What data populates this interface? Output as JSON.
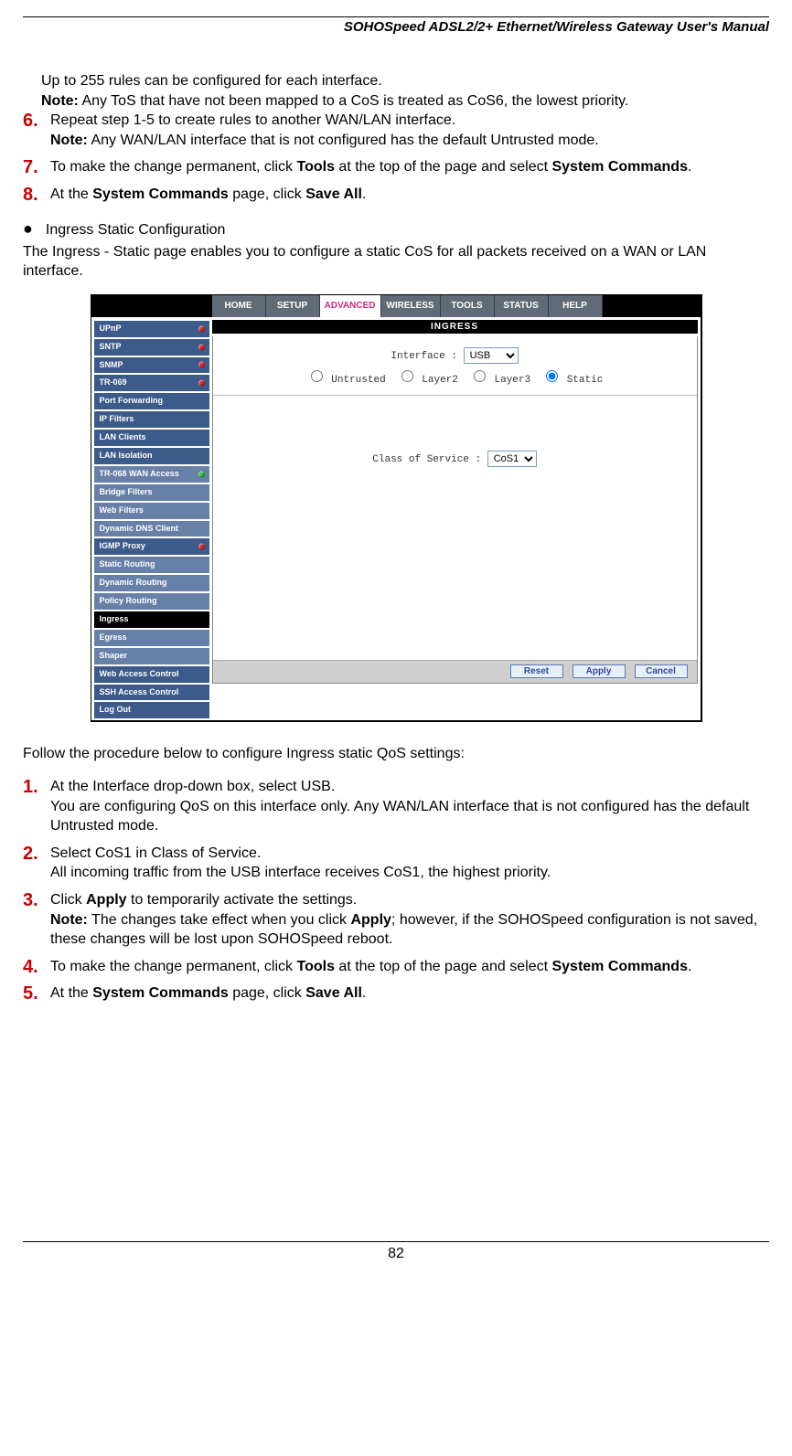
{
  "header": {
    "title": "SOHOSpeed ADSL2/2+ Ethernet/Wireless Gateway User's Manual"
  },
  "intro": {
    "line1": "Up to 255 rules can be configured for each interface.",
    "note_label": "Note:",
    "note_text": " Any ToS that have not been mapped to a CoS is treated as CoS6, the lowest priority."
  },
  "steps_a": [
    {
      "num": "6.",
      "text": "Repeat step 1-5 to create rules to another WAN/LAN interface.",
      "note_label": "Note:",
      "note_text": " Any WAN/LAN interface that is not configured has the default Untrusted mode."
    },
    {
      "num": "7.",
      "pre": "To make the change permanent, click ",
      "b1": "Tools",
      "mid": " at the top of the page and select ",
      "b2": "System Commands",
      "post": "."
    },
    {
      "num": "8.",
      "pre": "At the ",
      "b1": "System Commands",
      "mid": " page, click ",
      "b2": "Save All",
      "post": "."
    }
  ],
  "section": {
    "bullet": "●",
    "title": "Ingress Static Configuration",
    "desc": "The Ingress - Static page enables you to configure a static CoS for all packets received on a WAN or LAN interface."
  },
  "screenshot": {
    "tabs": [
      "HOME",
      "SETUP",
      "ADVANCED",
      "WIRELESS",
      "TOOLS",
      "STATUS",
      "HELP"
    ],
    "sidebar": [
      {
        "label": "UPnP",
        "dot": "red"
      },
      {
        "label": "SNTP",
        "dot": "red"
      },
      {
        "label": "SNMP",
        "dot": "red"
      },
      {
        "label": "TR-069",
        "dot": "red"
      },
      {
        "label": "Port Forwarding"
      },
      {
        "label": "IP Filters"
      },
      {
        "label": "LAN Clients"
      },
      {
        "label": "LAN Isolation"
      },
      {
        "label": "TR-068 WAN Access",
        "dim": true,
        "dot": "green"
      },
      {
        "label": "Bridge Filters",
        "dim": true
      },
      {
        "label": "Web Filters",
        "dim": true
      },
      {
        "label": "Dynamic DNS Client",
        "dim": true
      },
      {
        "label": "IGMP Proxy",
        "dot": "red"
      },
      {
        "label": "Static Routing",
        "dim": true
      },
      {
        "label": "Dynamic Routing",
        "dim": true
      },
      {
        "label": "Policy Routing",
        "dim": true
      },
      {
        "label": "Ingress",
        "active": true
      },
      {
        "label": "Egress",
        "dim": true
      },
      {
        "label": "Shaper",
        "dim": true
      },
      {
        "label": "Web Access Control"
      },
      {
        "label": "SSH Access Control"
      },
      {
        "label": "Log Out"
      }
    ],
    "panel": {
      "title": "INGRESS",
      "interface_label": "Interface :",
      "interface_value": "USB",
      "radios": [
        "Untrusted",
        "Layer2",
        "Layer3",
        "Static"
      ],
      "selected_radio": "Static",
      "cos_label": "Class of Service :",
      "cos_value": "CoS1",
      "buttons": [
        "Reset",
        "Apply",
        "Cancel"
      ]
    }
  },
  "follow": "Follow the procedure below to configure Ingress static QoS settings:",
  "steps_b": [
    {
      "num": "1.",
      "line1": "At the Interface drop-down box, select USB.",
      "line2": "You are configuring QoS on this interface only. Any WAN/LAN interface that is not configured has the default Untrusted mode."
    },
    {
      "num": "2.",
      "line1": "Select CoS1 in Class of Service.",
      "line2": "All incoming traffic from the USB interface receives CoS1, the highest priority."
    },
    {
      "num": "3.",
      "pre": "Click ",
      "b1": "Apply",
      "post1": " to temporarily activate the settings.",
      "note_label": "Note:",
      "note_pre": " The changes take effect when you click ",
      "b2": "Apply",
      "note_post": "; however, if the SOHOSpeed configuration is not saved, these changes will be lost upon SOHOSpeed reboot."
    },
    {
      "num": "4.",
      "pre": "To make the change permanent, click ",
      "b1": "Tools",
      "mid": " at the top of the page and select ",
      "b2": "System Commands",
      "post": "."
    },
    {
      "num": "5.",
      "pre": "At the ",
      "b1": "System Commands",
      "mid": " page, click ",
      "b2": "Save All",
      "post": "."
    }
  ],
  "page_number": "82"
}
